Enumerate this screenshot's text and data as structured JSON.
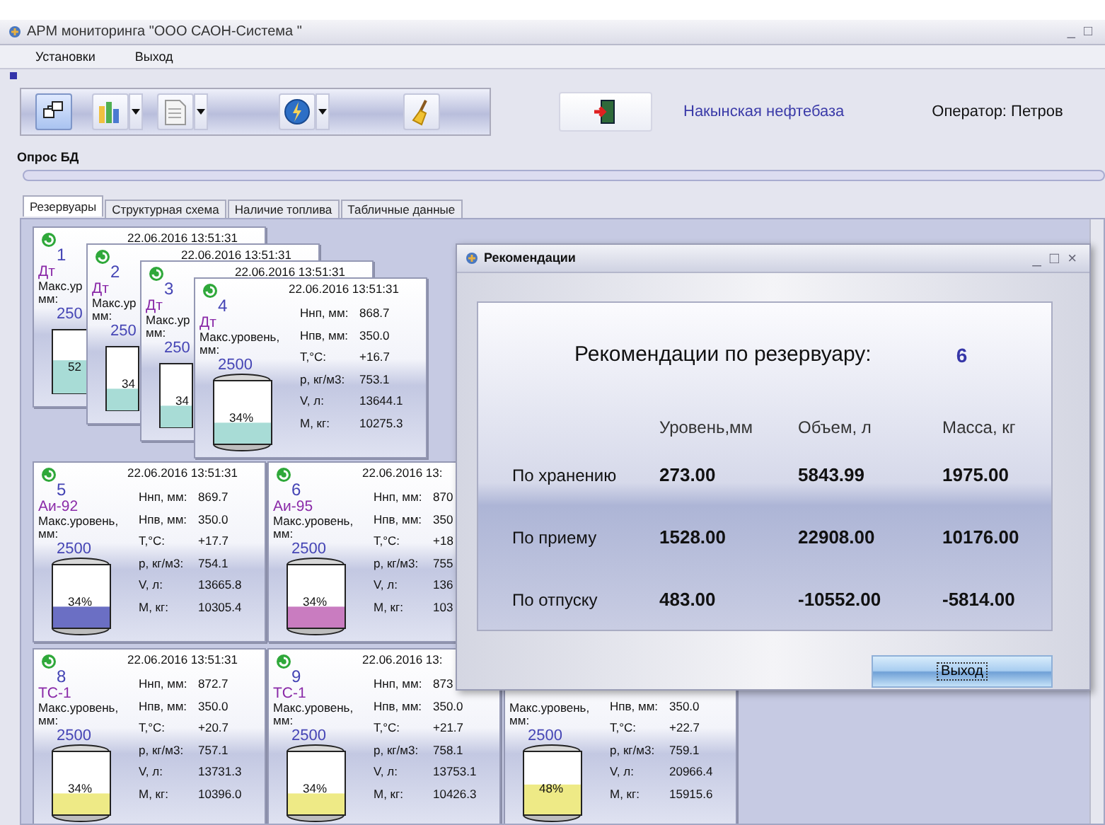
{
  "window": {
    "title": "АРМ мониторинга  \"ООО САОН-Система \"",
    "controls": [
      "_",
      "□"
    ]
  },
  "menu": [
    {
      "label": "Установки"
    },
    {
      "label": "Выход"
    }
  ],
  "toolbar": [
    {
      "kind": "nodes",
      "selected": true,
      "dropdown": false
    },
    {
      "kind": "chart",
      "selected": false,
      "dropdown": true
    },
    {
      "kind": "document",
      "selected": false,
      "dropdown": true
    },
    {
      "kind": "lightning",
      "selected": false,
      "dropdown": true
    },
    {
      "kind": "broom",
      "selected": false,
      "dropdown": false
    }
  ],
  "site": "Накынская нефтебаза",
  "operator": "Оператор: Петров",
  "poll": {
    "label": "Опрос БД",
    "level": 0
  },
  "tabs": [
    {
      "label": "Резервуары",
      "selected": true
    },
    {
      "label": "Структурная схема",
      "selected": false
    },
    {
      "label": "Наличие топлива",
      "selected": false
    },
    {
      "label": "Табличные данные",
      "selected": false
    }
  ],
  "tanks": [
    {
      "status": true,
      "date": "22.06.2016 13:51:31",
      "number": "1",
      "fuel": "Дт",
      "max_label": "Макс.ур",
      "unit": "мм:",
      "max": "250",
      "percent": "52",
      "level": 0.52,
      "color": "#a8dcd6"
    },
    {
      "status": true,
      "date": "22.06.2016 13:51:31",
      "number": "2",
      "fuel": "Дт",
      "max_label": "Макс.ур",
      "unit": "мм:",
      "max": "250",
      "percent": "34",
      "level": 0.34,
      "color": "#a8dcd6"
    },
    {
      "status": true,
      "date": "22.06.2016 13:51:31",
      "number": "3",
      "fuel": "Дт",
      "max_label": "Макс.ур",
      "unit": "мм:",
      "max": "250",
      "percent": "34",
      "level": 0.34,
      "color": "#a8dcd6"
    },
    {
      "status": true,
      "date": "22.06.2016 13:51:31",
      "number": "4",
      "fuel": "Дт",
      "max_label": "Макс.уровень,",
      "unit": "мм:",
      "max": "2500",
      "percent": "34%",
      "level": 0.34,
      "color": "#a8dcd6",
      "params": [
        {
          "label": "Ннп, мм:",
          "value": "868.7"
        },
        {
          "label": "Нпв, мм:",
          "value": "350.0"
        },
        {
          "label": "T,°C:",
          "value": "+16.7"
        },
        {
          "label": "p, кг/м3:",
          "value": "753.1"
        },
        {
          "label": "V, л:",
          "value": "13644.1"
        },
        {
          "label": "M, кг:",
          "value": "10275.3"
        }
      ]
    },
    {
      "status": true,
      "date": "22.06.2016 13:51:31",
      "number": "5",
      "fuel": "Аи-92",
      "max_label": "Макс.уровень,",
      "unit": "мм:",
      "max": "2500",
      "percent": "34%",
      "level": 0.34,
      "color": "#6b6fc4",
      "params": [
        {
          "label": "Ннп, мм:",
          "value": "869.7"
        },
        {
          "label": "Нпв, мм:",
          "value": "350.0"
        },
        {
          "label": "T,°C:",
          "value": "+17.7"
        },
        {
          "label": "p, кг/м3:",
          "value": "754.1"
        },
        {
          "label": "V, л:",
          "value": "13665.8"
        },
        {
          "label": "M, кг:",
          "value": "10305.4"
        }
      ]
    },
    {
      "status": true,
      "date": "22.06.2016 13:",
      "number": "6",
      "fuel": "Аи-95",
      "max_label": "Макс.уровень,",
      "unit": "мм:",
      "max": "2500",
      "percent": "34%",
      "level": 0.34,
      "color": "#c97cc0",
      "params": [
        {
          "label": "Ннп, мм:",
          "value": "870"
        },
        {
          "label": "Нпв, мм:",
          "value": "350"
        },
        {
          "label": "T,°C:",
          "value": "+18"
        },
        {
          "label": "p, кг/м3:",
          "value": "755"
        },
        {
          "label": "V, л:",
          "value": "136"
        },
        {
          "label": "M, кг:",
          "value": "103"
        }
      ]
    },
    {
      "status": true,
      "date": "22.06.2016 13:51:31",
      "number": "8",
      "fuel": "ТС-1",
      "max_label": "Макс.уровень,",
      "unit": "мм:",
      "max": "2500",
      "percent": "34%",
      "level": 0.34,
      "color": "#eeea86",
      "params": [
        {
          "label": "Ннп, мм:",
          "value": "872.7"
        },
        {
          "label": "Нпв, мм:",
          "value": "350.0"
        },
        {
          "label": "T,°C:",
          "value": "+20.7"
        },
        {
          "label": "p, кг/м3:",
          "value": "757.1"
        },
        {
          "label": "V, л:",
          "value": "13731.3"
        },
        {
          "label": "M, кг:",
          "value": "10396.0"
        }
      ]
    },
    {
      "status": true,
      "date": "22.06.2016 13:",
      "number": "9",
      "fuel": "ТС-1",
      "max_label": "Макс.уровень,",
      "unit": "мм:",
      "max": "2500",
      "percent": "34%",
      "level": 0.34,
      "color": "#eeea86",
      "params": [
        {
          "label": "Ннп, мм:",
          "value": "873"
        },
        {
          "label": "Нпв, мм:",
          "value": "350.0"
        },
        {
          "label": "T,°C:",
          "value": "+21.7"
        },
        {
          "label": "p, кг/м3:",
          "value": "758.1"
        },
        {
          "label": "V, л:",
          "value": "13753.1"
        },
        {
          "label": "M, кг:",
          "value": "10426.3"
        }
      ]
    },
    {
      "max_label": "Макс.уровень,",
      "unit": "мм:",
      "max": "2500",
      "percent": "48%",
      "level": 0.48,
      "color": "#eeea86",
      "params": [
        {
          "label": "Нпв, мм:",
          "value": "350.0"
        },
        {
          "label": "T,°C:",
          "value": "+22.7"
        },
        {
          "label": "p, кг/м3:",
          "value": "759.1"
        },
        {
          "label": "V, л:",
          "value": "20966.4"
        },
        {
          "label": "M, кг:",
          "value": "15915.6"
        }
      ]
    }
  ],
  "dialog": {
    "title": "Рекомендации",
    "controls": [
      "_",
      "□",
      "×"
    ],
    "heading": "Рекомендации по резервуару:",
    "tank": "6",
    "columns": [
      "Уровень,мм",
      "Объем, л",
      "Масса, кг"
    ],
    "rows": [
      {
        "label": "По хранению",
        "values": [
          "273.00",
          "5843.99",
          "1975.00"
        ]
      },
      {
        "label": "По приему",
        "values": [
          "1528.00",
          "22908.00",
          "10176.00"
        ]
      },
      {
        "label": "По отпуску",
        "values": [
          "483.00",
          "-10552.00",
          "-5814.00"
        ]
      }
    ],
    "button": "Выход"
  }
}
